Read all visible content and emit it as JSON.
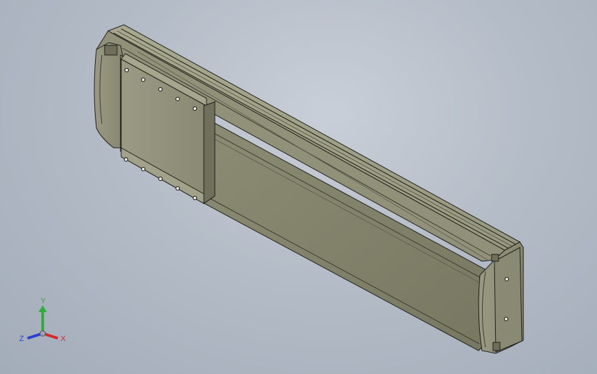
{
  "viewport": {
    "background_color": "#b6bdc8",
    "model": {
      "name": "linear-actuator-module",
      "body_color": "#8f9078",
      "edge_color": "#1e1e18"
    }
  },
  "triad": {
    "x_label": "X",
    "y_label": "Y",
    "z_label": "Z",
    "x_color": "#d42a2a",
    "y_color": "#2fae3a",
    "z_color": "#2a3fd4"
  }
}
